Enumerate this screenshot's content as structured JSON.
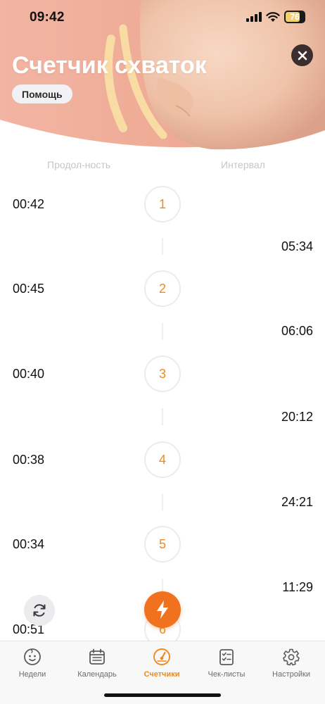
{
  "status_bar": {
    "time": "09:42",
    "battery": "76",
    "battery_level": 0.76
  },
  "header": {
    "title": "Счетчик схваток",
    "help_label": "Помощь",
    "close_icon": "close-icon"
  },
  "columns": {
    "duration": "Продол-ность",
    "interval": "Интервал"
  },
  "contractions": [
    {
      "number": "1",
      "duration": "00:42",
      "interval": "05:34"
    },
    {
      "number": "2",
      "duration": "00:45",
      "interval": "06:06"
    },
    {
      "number": "3",
      "duration": "00:40",
      "interval": "20:12"
    },
    {
      "number": "4",
      "duration": "00:38",
      "interval": "24:21"
    },
    {
      "number": "5",
      "duration": "00:34",
      "interval": "11:29"
    },
    {
      "number": "6",
      "duration": "00:51",
      "interval": ""
    }
  ],
  "actions": {
    "refresh_icon": "refresh-icon",
    "start_icon": "lightning-icon"
  },
  "tabs": [
    {
      "label": "Недели",
      "icon": "baby-face-icon",
      "active": false
    },
    {
      "label": "Календарь",
      "icon": "calendar-icon",
      "active": false
    },
    {
      "label": "Счетчики",
      "icon": "gauge-icon",
      "active": true
    },
    {
      "label": "Чек-листы",
      "icon": "checklist-icon",
      "active": false
    },
    {
      "label": "Настройки",
      "icon": "gear-icon",
      "active": false
    }
  ],
  "colors": {
    "accent": "#f08a1e",
    "action": "#f0711e",
    "header_bg": "#ecae9a"
  }
}
